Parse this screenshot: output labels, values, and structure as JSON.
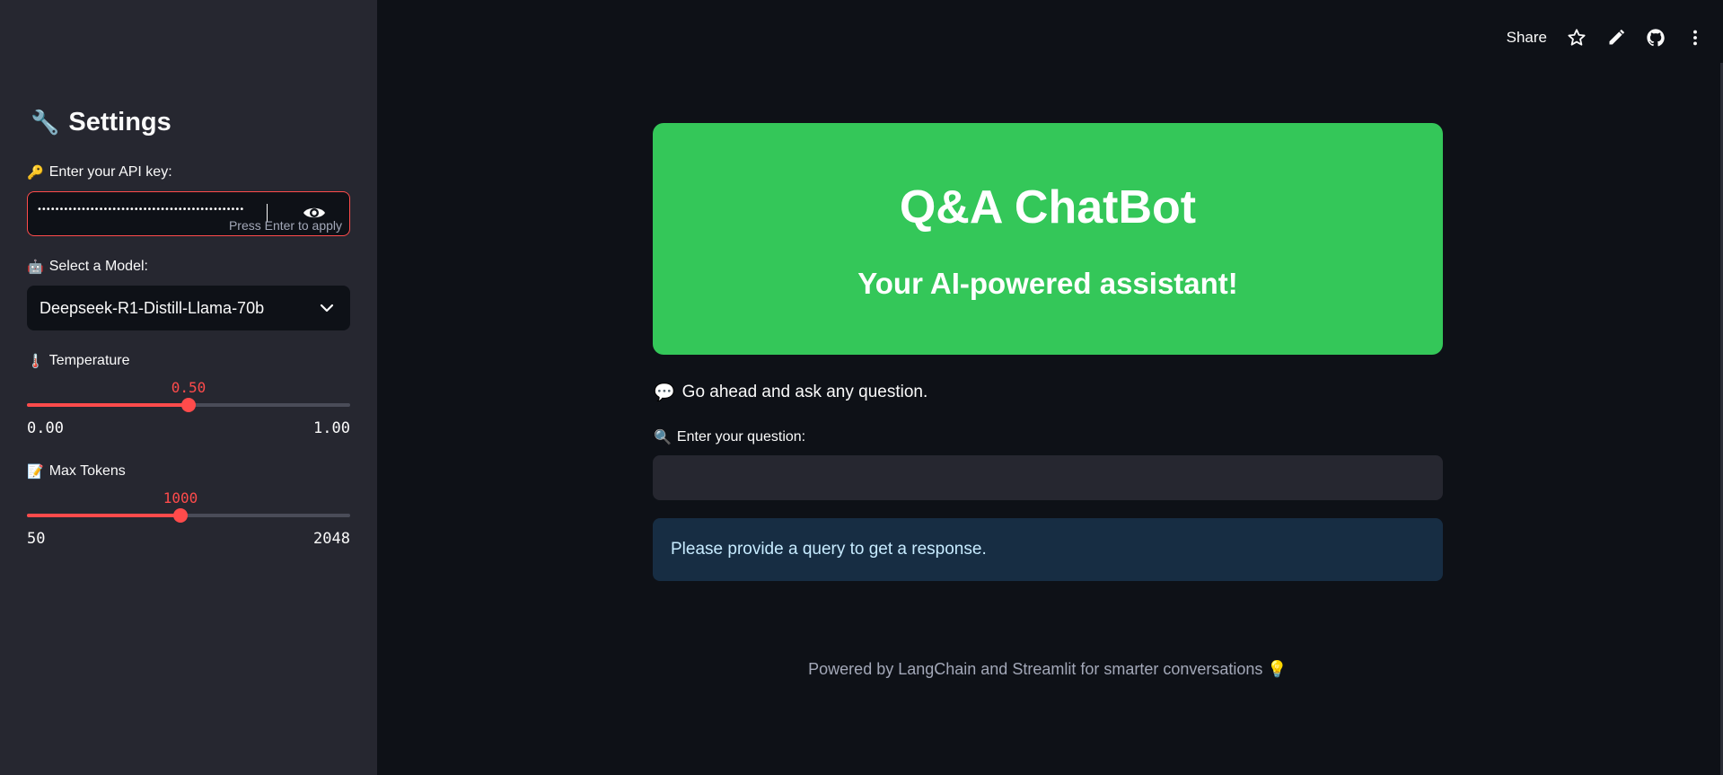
{
  "sidebar": {
    "title": "Settings",
    "title_emoji": "🔧",
    "api_key": {
      "emoji": "🔑",
      "label": "Enter your API key:",
      "masked_value": "•••••••••••••••••••••••••••••••••••••••••••••••",
      "hint": "Press Enter to apply",
      "toggle_icon": "eye-icon"
    },
    "model": {
      "emoji": "🤖",
      "label": "Select a Model:",
      "selected": "Deepseek-R1-Distill-Llama-70b"
    },
    "temperature": {
      "emoji": "🌡️",
      "label": "Temperature",
      "value": "0.50",
      "min": "0.00",
      "max": "1.00",
      "fraction": 0.5
    },
    "max_tokens": {
      "emoji": "📝",
      "label": "Max Tokens",
      "value": "1000",
      "min": "50",
      "max": "2048",
      "fraction": 0.475
    }
  },
  "toolbar": {
    "share_label": "Share",
    "icons": [
      "star-icon",
      "pencil-icon",
      "github-icon",
      "more-vertical-icon"
    ]
  },
  "main": {
    "hero_title": "Q&A ChatBot",
    "hero_subtitle": "Your AI-powered assistant!",
    "prompt_emoji": "💬",
    "prompt": "Go ahead and ask any question.",
    "question_emoji": "🔍",
    "question_label": "Enter your question:",
    "question_value": "",
    "info": "Please provide a query to get a response.",
    "footer": "Powered by LangChain and Streamlit for smarter conversations 💡"
  },
  "colors": {
    "accent": "#ff4b4b",
    "hero": "#34c759",
    "sidebar_bg": "#262730",
    "main_bg": "#0e1117",
    "info_bg": "#172d43"
  }
}
